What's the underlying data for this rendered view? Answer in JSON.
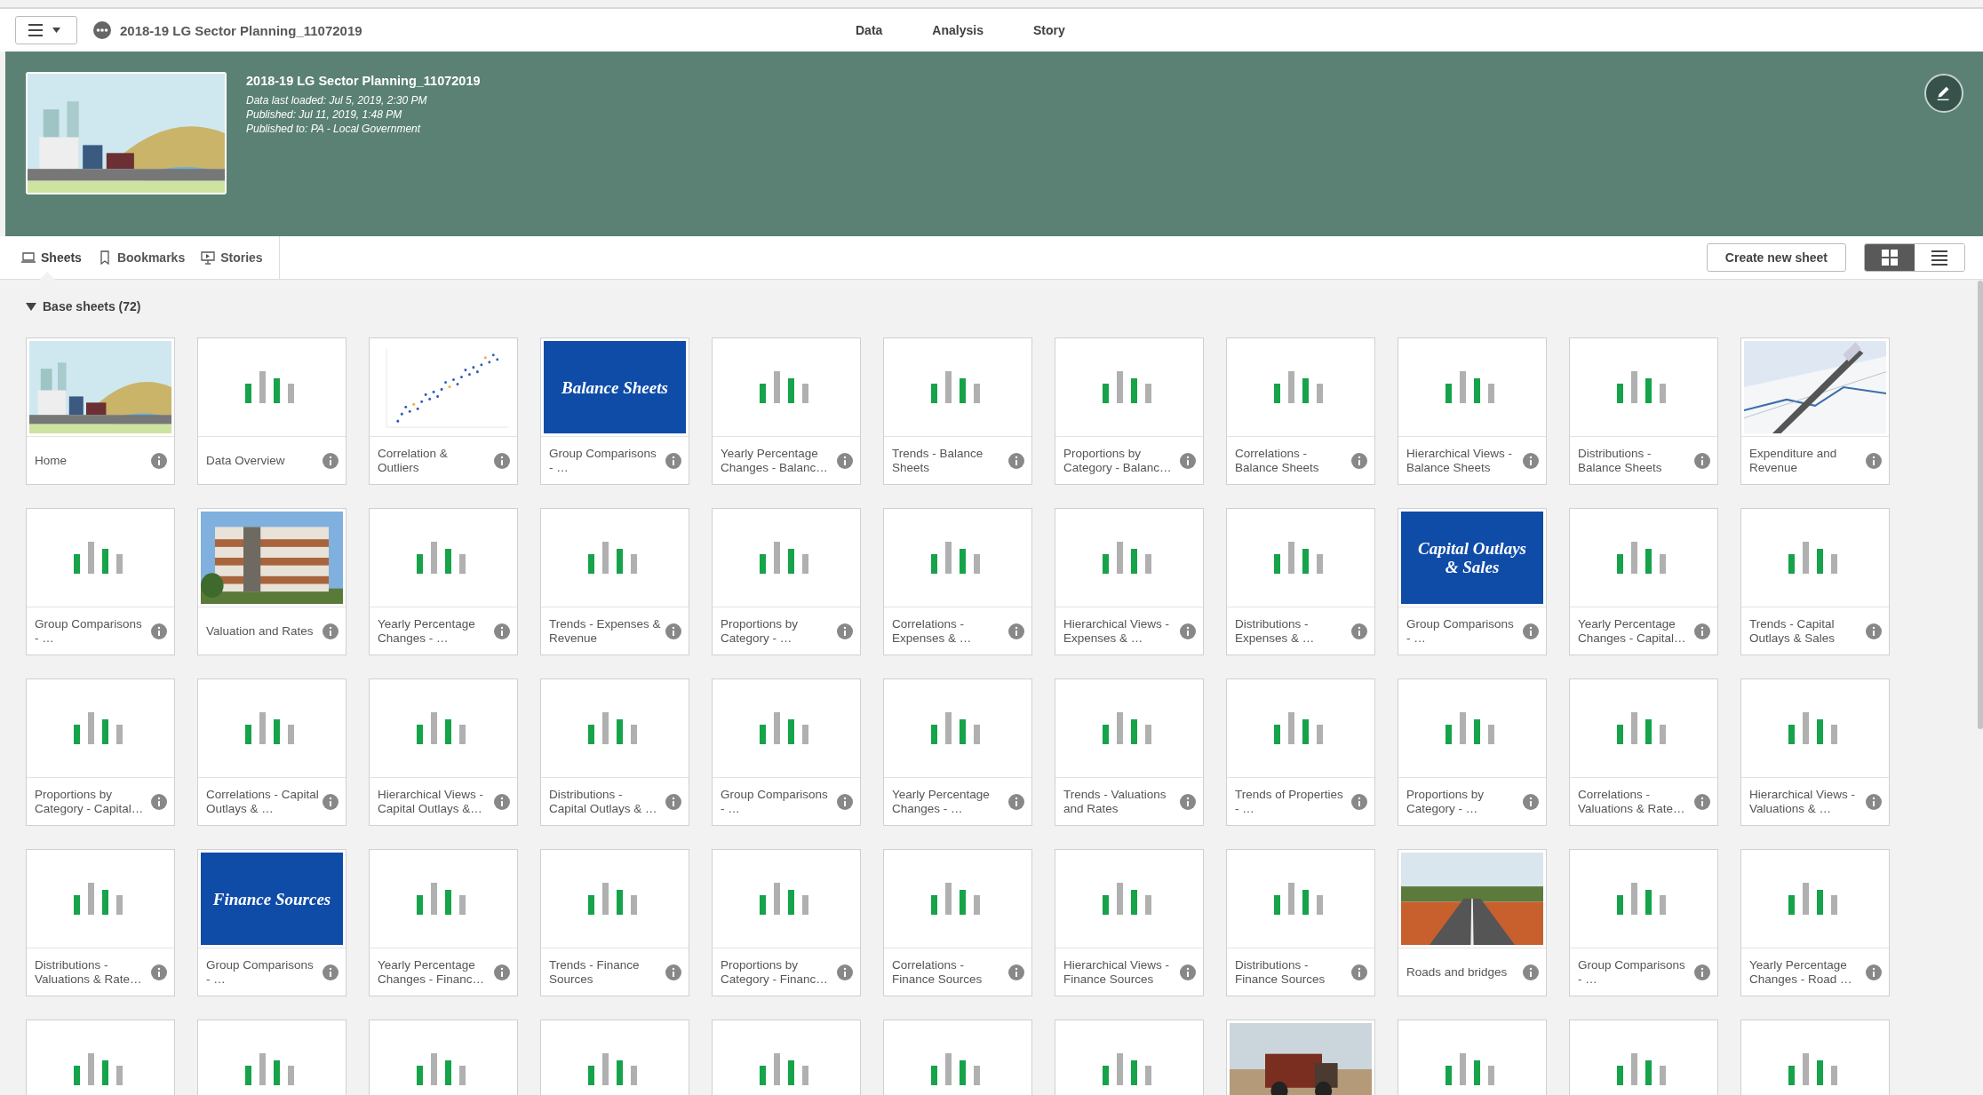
{
  "top_bar": {
    "app_title": "2018-19 LG Sector Planning_11072019",
    "nav": [
      {
        "label": "Data"
      },
      {
        "label": "Analysis"
      },
      {
        "label": "Story"
      }
    ]
  },
  "header": {
    "thumbnail": {
      "kind": "picture"
    },
    "title": "2018-19 LG Sector Planning_11072019",
    "details": [
      "Data last loaded: Jul 5, 2019, 2:30 PM",
      "Published: Jul 11, 2019, 1:48 PM",
      "Published to: PA - Local Government"
    ]
  },
  "tabs": [
    {
      "label": "Sheets",
      "kind": "sheets",
      "selected": true
    },
    {
      "label": "Bookmarks",
      "kind": "bookmarks",
      "selected": false
    },
    {
      "label": "Stories",
      "kind": "stories",
      "selected": false
    }
  ],
  "create_button": "Create new sheet",
  "view_modes": [
    {
      "kind": "grid",
      "selected": true
    },
    {
      "kind": "list",
      "selected": false
    }
  ],
  "section": {
    "title": "Base sheets (72)",
    "expanded": true,
    "sheets": [
      {
        "label": "Home",
        "kind": "picture"
      },
      {
        "label": "Data Overview",
        "kind": "bars"
      },
      {
        "label": "Correlation & Outliers",
        "kind": "scatter"
      },
      {
        "label": "Group Comparisons - …",
        "kind": "title",
        "thumb_text": "Balance Sheets"
      },
      {
        "label": "Yearly Percentage Changes - Balanc…",
        "kind": "bars"
      },
      {
        "label": "Trends - Balance Sheets",
        "kind": "bars"
      },
      {
        "label": "Proportions by Category - Balanc…",
        "kind": "bars"
      },
      {
        "label": "Correlations - Balance Sheets",
        "kind": "bars"
      },
      {
        "label": "Hierarchical Views - Balance Sheets",
        "kind": "bars"
      },
      {
        "label": "Distributions - Balance Sheets",
        "kind": "bars"
      },
      {
        "label": "Expenditure and Revenue",
        "kind": "picture"
      },
      {
        "label": "Group Comparisons - …",
        "kind": "bars"
      },
      {
        "label": "Valuation and Rates",
        "kind": "picture"
      },
      {
        "label": "Yearly Percentage Changes - …",
        "kind": "bars"
      },
      {
        "label": "Trends - Expenses & Revenue",
        "kind": "bars"
      },
      {
        "label": "Proportions by Category - …",
        "kind": "bars"
      },
      {
        "label": "Correlations - Expenses & …",
        "kind": "bars"
      },
      {
        "label": "Hierarchical Views - Expenses & …",
        "kind": "bars"
      },
      {
        "label": "Distributions - Expenses & …",
        "kind": "bars"
      },
      {
        "label": "Group Comparisons - …",
        "kind": "title",
        "thumb_text": "Capital Outlays & Sales"
      },
      {
        "label": "Yearly Percentage Changes - Capital…",
        "kind": "bars"
      },
      {
        "label": "Trends - Capital Outlays & Sales",
        "kind": "bars"
      },
      {
        "label": "Proportions by Category - Capital…",
        "kind": "bars"
      },
      {
        "label": "Correlations - Capital Outlays & …",
        "kind": "bars"
      },
      {
        "label": "Hierarchical Views - Capital Outlays &…",
        "kind": "bars"
      },
      {
        "label": "Distributions - Capital Outlays & …",
        "kind": "bars"
      },
      {
        "label": "Group Comparisons - …",
        "kind": "bars"
      },
      {
        "label": "Yearly Percentage Changes - …",
        "kind": "bars"
      },
      {
        "label": "Trends - Valuations and Rates",
        "kind": "bars"
      },
      {
        "label": "Trends of Properties - …",
        "kind": "bars"
      },
      {
        "label": "Proportions by Category - …",
        "kind": "bars"
      },
      {
        "label": "Correlations - Valuations & Rate…",
        "kind": "bars"
      },
      {
        "label": "Hierarchical Views - Valuations & …",
        "kind": "bars"
      },
      {
        "label": "Distributions - Valuations & Rate…",
        "kind": "bars"
      },
      {
        "label": "Group Comparisons - …",
        "kind": "title",
        "thumb_text": "Finance Sources"
      },
      {
        "label": "Yearly Percentage Changes - Financ…",
        "kind": "bars"
      },
      {
        "label": "Trends - Finance Sources",
        "kind": "bars"
      },
      {
        "label": "Proportions by Category - Financ…",
        "kind": "bars"
      },
      {
        "label": "Correlations - Finance Sources",
        "kind": "bars"
      },
      {
        "label": "Hierarchical Views - Finance Sources",
        "kind": "bars"
      },
      {
        "label": "Distributions - Finance Sources",
        "kind": "bars"
      },
      {
        "label": "Roads and bridges",
        "kind": "picture"
      },
      {
        "label": "Group Comparisons - …",
        "kind": "bars"
      },
      {
        "label": "Yearly Percentage Changes - Road …",
        "kind": "bars"
      },
      {
        "kind": "bars"
      },
      {
        "kind": "bars"
      },
      {
        "kind": "bars"
      },
      {
        "kind": "bars"
      },
      {
        "kind": "bars"
      },
      {
        "kind": "bars"
      },
      {
        "kind": "bars"
      },
      {
        "kind": "picture"
      },
      {
        "kind": "bars"
      },
      {
        "kind": "bars"
      },
      {
        "kind": "bars"
      }
    ]
  }
}
